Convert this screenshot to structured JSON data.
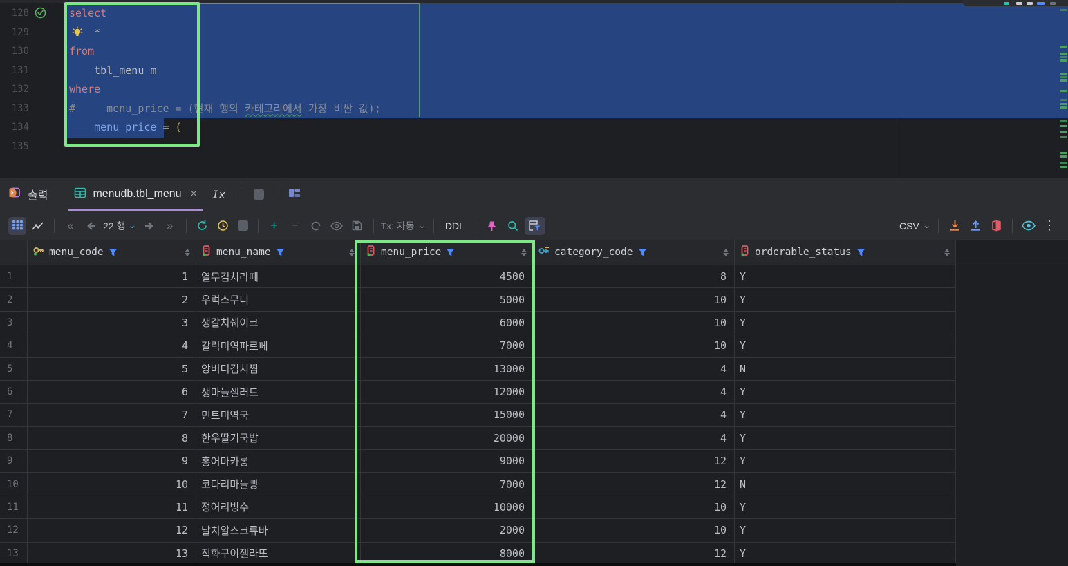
{
  "editor": {
    "lines": [
      {
        "num": "128",
        "tokens": [
          [
            "k",
            "select"
          ]
        ]
      },
      {
        "num": "129",
        "tokens": [
          [
            "p",
            "    *"
          ]
        ]
      },
      {
        "num": "130",
        "tokens": [
          [
            "k",
            "from"
          ]
        ]
      },
      {
        "num": "131",
        "tokens": [
          [
            "p",
            "    tbl_menu m"
          ]
        ]
      },
      {
        "num": "132",
        "tokens": [
          [
            "k",
            "where"
          ]
        ]
      },
      {
        "num": "133",
        "tokens": [
          [
            "c",
            "#     menu_price = ("
          ],
          [
            "c",
            "현재 행의 "
          ],
          [
            "csq",
            "카테고리에서"
          ],
          [
            "c",
            " 가장 비싼 값);"
          ]
        ]
      },
      {
        "num": "134",
        "tokens": [
          [
            "p",
            "    "
          ],
          [
            "col",
            "menu_price"
          ],
          [
            "p",
            " = "
          ],
          [
            "par",
            "("
          ]
        ]
      },
      {
        "num": "135",
        "tokens": []
      }
    ],
    "scroll_marks": [
      13,
      66,
      76,
      81,
      86,
      105,
      110,
      115,
      130,
      143,
      149,
      154,
      174,
      181,
      189,
      197,
      220,
      225,
      234,
      240
    ]
  },
  "tabs": {
    "output": "출력",
    "result": "menudb.tbl_menu",
    "close": "×",
    "ix": "Ix"
  },
  "toolbar": {
    "first": "«",
    "prev": "",
    "rows": "22 행",
    "next": "",
    "last": "»",
    "rows_chevron": "⌄",
    "tx": "Tx: 자동",
    "tx_chevron": "⌄",
    "ddl": "DDL",
    "csv": "CSV",
    "csv_chevron": "⌄",
    "kebab": "⋮"
  },
  "grid": {
    "columns": [
      {
        "name": "menu_code",
        "icon": "primary-key-icon",
        "align": "right"
      },
      {
        "name": "menu_name",
        "icon": "column-icon",
        "align": "left"
      },
      {
        "name": "menu_price",
        "icon": "column-icon",
        "align": "right"
      },
      {
        "name": "category_code",
        "icon": "foreign-key-icon",
        "align": "right"
      },
      {
        "name": "orderable_status",
        "icon": "column-icon",
        "align": "left"
      }
    ],
    "rows": [
      [
        "1",
        "1",
        "열무김치라떼",
        "4500",
        "8",
        "Y"
      ],
      [
        "2",
        "2",
        "우럭스무디",
        "5000",
        "10",
        "Y"
      ],
      [
        "3",
        "3",
        "생갈치쉐이크",
        "6000",
        "10",
        "Y"
      ],
      [
        "4",
        "4",
        "갈릭미역파르페",
        "7000",
        "10",
        "Y"
      ],
      [
        "5",
        "5",
        "앙버터김치찜",
        "13000",
        "4",
        "N"
      ],
      [
        "6",
        "6",
        "생마늘샐러드",
        "12000",
        "4",
        "Y"
      ],
      [
        "7",
        "7",
        "민트미역국",
        "15000",
        "4",
        "Y"
      ],
      [
        "8",
        "8",
        "한우딸기국밥",
        "20000",
        "4",
        "Y"
      ],
      [
        "9",
        "9",
        "홍어마카롱",
        "9000",
        "12",
        "Y"
      ],
      [
        "10",
        "10",
        "코다리마늘빵",
        "7000",
        "12",
        "N"
      ],
      [
        "11",
        "11",
        "정어리빙수",
        "10000",
        "10",
        "Y"
      ],
      [
        "12",
        "12",
        "날치알스크류바",
        "2000",
        "10",
        "Y"
      ],
      [
        "13",
        "13",
        "직화구이젤라또",
        "8000",
        "12",
        "Y"
      ]
    ]
  },
  "icons": [
    "statement-ok-check-icon",
    "intention-bulb-icon",
    "console-output-icon",
    "table-icon",
    "close-icon",
    "stop-icon",
    "layout-icon",
    "grid-view-icon",
    "chart-view-icon",
    "first-page-icon",
    "prev-page-icon",
    "chevron-down-icon",
    "next-page-icon",
    "last-page-icon",
    "refresh-icon",
    "history-icon",
    "add-row-icon",
    "delete-row-icon",
    "revert-icon",
    "preview-icon",
    "save-icon",
    "pin-icon",
    "search-icon",
    "table-filter-icon",
    "download-icon",
    "upload-icon",
    "compare-icon",
    "eye-icon",
    "kebab-menu-icon",
    "primary-key-icon",
    "foreign-key-icon",
    "column-icon",
    "filter-funnel-icon",
    "sort-icon"
  ],
  "colors": {
    "annotation_green": "#7ee787",
    "selection_blue": "#254480",
    "accent_blue": "#548af7",
    "teal": "#2dbcad",
    "yellow": "#d8b05c",
    "orange": "#e08855",
    "salmon": "#e55765",
    "pink": "#e264c6",
    "tab_underline": "#a98fc9",
    "cyan": "#56c1d6"
  }
}
